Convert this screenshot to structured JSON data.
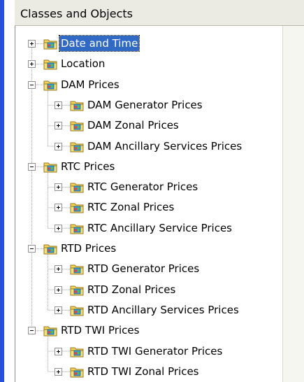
{
  "header": {
    "title": "Classes and Objects"
  },
  "tree": [
    {
      "label": "Date and Time",
      "level": 0,
      "state": "collapsed",
      "selected": true
    },
    {
      "label": "Location",
      "level": 0,
      "state": "collapsed"
    },
    {
      "label": "DAM Prices",
      "level": 0,
      "state": "expanded"
    },
    {
      "label": "DAM Generator Prices",
      "level": 1,
      "state": "collapsed"
    },
    {
      "label": "DAM Zonal Prices",
      "level": 1,
      "state": "collapsed"
    },
    {
      "label": "DAM Ancillary Services Prices",
      "level": 1,
      "state": "collapsed"
    },
    {
      "label": "RTC Prices",
      "level": 0,
      "state": "expanded"
    },
    {
      "label": "RTC Generator Prices",
      "level": 1,
      "state": "collapsed"
    },
    {
      "label": "RTC Zonal Prices",
      "level": 1,
      "state": "collapsed"
    },
    {
      "label": "RTC Ancillary Service Prices",
      "level": 1,
      "state": "collapsed"
    },
    {
      "label": "RTD Prices",
      "level": 0,
      "state": "expanded"
    },
    {
      "label": "RTD Generator Prices",
      "level": 1,
      "state": "collapsed"
    },
    {
      "label": "RTD Zonal Prices",
      "level": 1,
      "state": "collapsed"
    },
    {
      "label": "RTD Ancillary Services Prices",
      "level": 1,
      "state": "collapsed"
    },
    {
      "label": "RTD TWI Prices",
      "level": 0,
      "state": "expanded"
    },
    {
      "label": "RTD TWI Generator Prices",
      "level": 1,
      "state": "collapsed"
    },
    {
      "label": "RTD TWI Zonal Prices",
      "level": 1,
      "state": "collapsed"
    }
  ],
  "icons": {
    "node": "folder-cube-icon",
    "expand": "plus-box-icon",
    "collapse": "minus-box-icon"
  },
  "colors": {
    "selection": "#316ac5",
    "accent_bar": "#2453d8",
    "header": "#ecebe3"
  }
}
